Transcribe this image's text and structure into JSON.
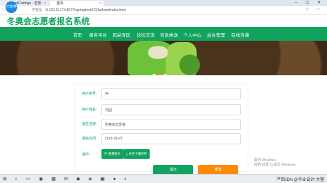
{
  "browser": {
    "tabs": [
      {
        "title": "studentCatdogs - 志愿 -"
      },
      {
        "title": "首页"
      }
    ],
    "url": "8.129.11.174:8077/springboot9731a/front/index.html",
    "insecure_label": "不安全",
    "avatar_label": "已暂停"
  },
  "site": {
    "title": "冬奥会志愿者报名系统",
    "nav": [
      "首页",
      "报名平台",
      "风采专区",
      "论坛交流",
      "信息推送",
      "个人中心",
      "后台管理",
      "在线沟通"
    ]
  },
  "banner": {
    "slides": 3,
    "active_slide": 2
  },
  "form": {
    "fields": [
      {
        "label": "用户账号:",
        "value": "04"
      },
      {
        "label": "用户姓名:",
        "value": "刘园"
      },
      {
        "label": "报名名称:",
        "value": "冬奥会志愿者"
      },
      {
        "label": "报名时间:",
        "value": "2021-09-25"
      }
    ],
    "upload_label": "操作:",
    "upload_buttons": [
      "查看图片",
      "点击下载附件"
    ],
    "submit_label": "提交",
    "reset_label": "重置"
  },
  "watermark": [
    "激活 Windows",
    "转到“设置”以激活 Windows。"
  ],
  "taskbar": {
    "weather": "34°C",
    "csdn": "CSDN @毕业设计-大猩"
  },
  "colors": {
    "brand": "#12a35f",
    "accent": "#ff8a00"
  }
}
